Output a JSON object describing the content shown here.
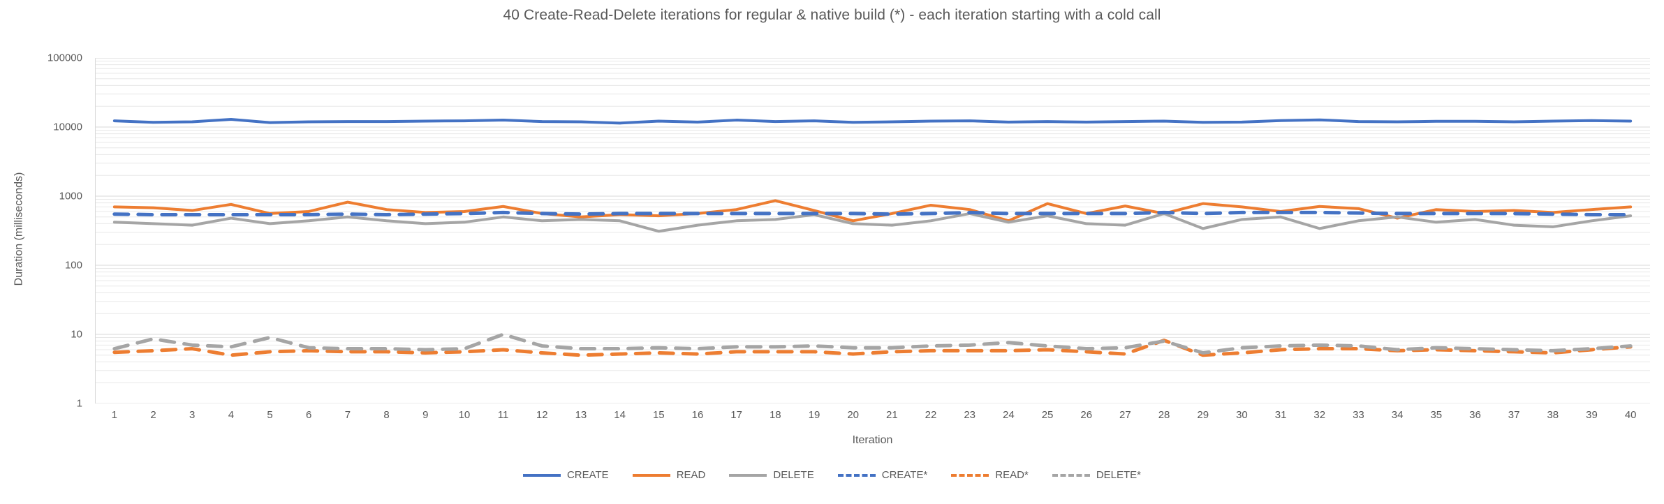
{
  "chart_data": {
    "type": "line",
    "title": "40 Create-Read-Delete iterations for regular & native build (*) - each iteration starting with a cold call",
    "xlabel": "Iteration",
    "ylabel": "Duration (milliseconds)",
    "yscale": "log",
    "ylim": [
      1,
      100000
    ],
    "ytick_labels": [
      "100000",
      "10000",
      "1000",
      "100",
      "10",
      "1"
    ],
    "ytick_values": [
      100000,
      10000,
      1000,
      100,
      10,
      1
    ],
    "grid": true,
    "grid_minor": true,
    "legend_position": "bottom",
    "categories": [
      1,
      2,
      3,
      4,
      5,
      6,
      7,
      8,
      9,
      10,
      11,
      12,
      13,
      14,
      15,
      16,
      17,
      18,
      19,
      20,
      21,
      22,
      23,
      24,
      25,
      26,
      27,
      28,
      29,
      30,
      31,
      32,
      33,
      34,
      35,
      36,
      37,
      38,
      39,
      40
    ],
    "series": [
      {
        "name": "CREATE",
        "color": "#4472C4",
        "style": "solid",
        "values": [
          12300,
          11700,
          11900,
          12900,
          11600,
          11900,
          12000,
          12000,
          12200,
          12300,
          12600,
          12000,
          11900,
          11400,
          12200,
          11800,
          12600,
          12000,
          12300,
          11700,
          11900,
          12200,
          12300,
          11800,
          12000,
          11800,
          12000,
          12200,
          11700,
          11800,
          12400,
          12700,
          12000,
          11900,
          12100,
          12100,
          11900,
          12200,
          12400,
          12200
        ]
      },
      {
        "name": "READ",
        "color": "#ED7D31",
        "style": "solid",
        "values": [
          700,
          680,
          620,
          760,
          560,
          600,
          820,
          640,
          580,
          600,
          710,
          560,
          500,
          540,
          520,
          560,
          640,
          860,
          620,
          440,
          560,
          740,
          640,
          440,
          780,
          560,
          720,
          560,
          780,
          700,
          600,
          710,
          660,
          480,
          640,
          600,
          620,
          580,
          640,
          700
        ]
      },
      {
        "name": "DELETE",
        "color": "#A5A5A5",
        "style": "solid",
        "values": [
          420,
          400,
          380,
          480,
          400,
          440,
          500,
          440,
          400,
          420,
          500,
          440,
          460,
          440,
          310,
          380,
          440,
          460,
          540,
          400,
          380,
          440,
          560,
          420,
          520,
          400,
          380,
          560,
          340,
          460,
          500,
          340,
          440,
          500,
          420,
          460,
          380,
          360,
          440,
          520
        ]
      },
      {
        "name": "CREATE*",
        "color": "#4472C4",
        "style": "dashed",
        "values": [
          550,
          540,
          540,
          540,
          540,
          540,
          550,
          540,
          550,
          560,
          580,
          560,
          550,
          560,
          560,
          560,
          560,
          560,
          560,
          560,
          550,
          560,
          580,
          560,
          560,
          560,
          560,
          580,
          560,
          580,
          580,
          580,
          570,
          560,
          560,
          560,
          560,
          550,
          540,
          540
        ]
      },
      {
        "name": "READ*",
        "color": "#ED7D31",
        "style": "dashed",
        "values": [
          5.5,
          5.8,
          6.2,
          5.0,
          5.6,
          5.8,
          5.6,
          5.6,
          5.4,
          5.6,
          6.0,
          5.4,
          5.0,
          5.2,
          5.4,
          5.2,
          5.6,
          5.6,
          5.6,
          5.2,
          5.6,
          5.8,
          5.8,
          5.8,
          6.0,
          5.6,
          5.2,
          8.2,
          5.0,
          5.4,
          6.0,
          6.2,
          6.2,
          5.8,
          6.0,
          5.8,
          5.6,
          5.4,
          6.0,
          6.6
        ]
      },
      {
        "name": "DELETE*",
        "color": "#A5A5A5",
        "style": "dashed",
        "values": [
          6.2,
          8.6,
          7.0,
          6.6,
          9.0,
          6.4,
          6.2,
          6.2,
          6.0,
          6.2,
          10.0,
          6.8,
          6.2,
          6.2,
          6.4,
          6.2,
          6.6,
          6.6,
          6.8,
          6.4,
          6.4,
          6.8,
          7.0,
          7.6,
          6.8,
          6.2,
          6.4,
          8.0,
          5.4,
          6.4,
          6.8,
          7.0,
          6.8,
          6.0,
          6.4,
          6.2,
          6.0,
          5.8,
          6.2,
          6.8
        ]
      }
    ]
  },
  "legend": {
    "items": [
      {
        "label": "CREATE",
        "color": "#4472C4",
        "style": "solid"
      },
      {
        "label": "READ",
        "color": "#ED7D31",
        "style": "solid"
      },
      {
        "label": "DELETE",
        "color": "#A5A5A5",
        "style": "solid"
      },
      {
        "label": "CREATE*",
        "color": "#4472C4",
        "style": "dashed"
      },
      {
        "label": "READ*",
        "color": "#ED7D31",
        "style": "dashed"
      },
      {
        "label": "DELETE*",
        "color": "#A5A5A5",
        "style": "dashed"
      }
    ]
  },
  "axes": {
    "y_tick_labels": [
      "100000",
      "10000",
      "1000",
      "100",
      "10",
      "1"
    ],
    "x_tick_labels": [
      "1",
      "2",
      "3",
      "4",
      "5",
      "6",
      "7",
      "8",
      "9",
      "10",
      "11",
      "12",
      "13",
      "14",
      "15",
      "16",
      "17",
      "18",
      "19",
      "20",
      "21",
      "22",
      "23",
      "24",
      "25",
      "26",
      "27",
      "28",
      "29",
      "30",
      "31",
      "32",
      "33",
      "34",
      "35",
      "36",
      "37",
      "38",
      "39",
      "40"
    ]
  },
  "colors": {
    "create": "#4472C4",
    "read": "#ED7D31",
    "delete": "#A5A5A5",
    "text": "#595959",
    "gridline": "#E8E8E8",
    "background": "#FFFFFF"
  }
}
